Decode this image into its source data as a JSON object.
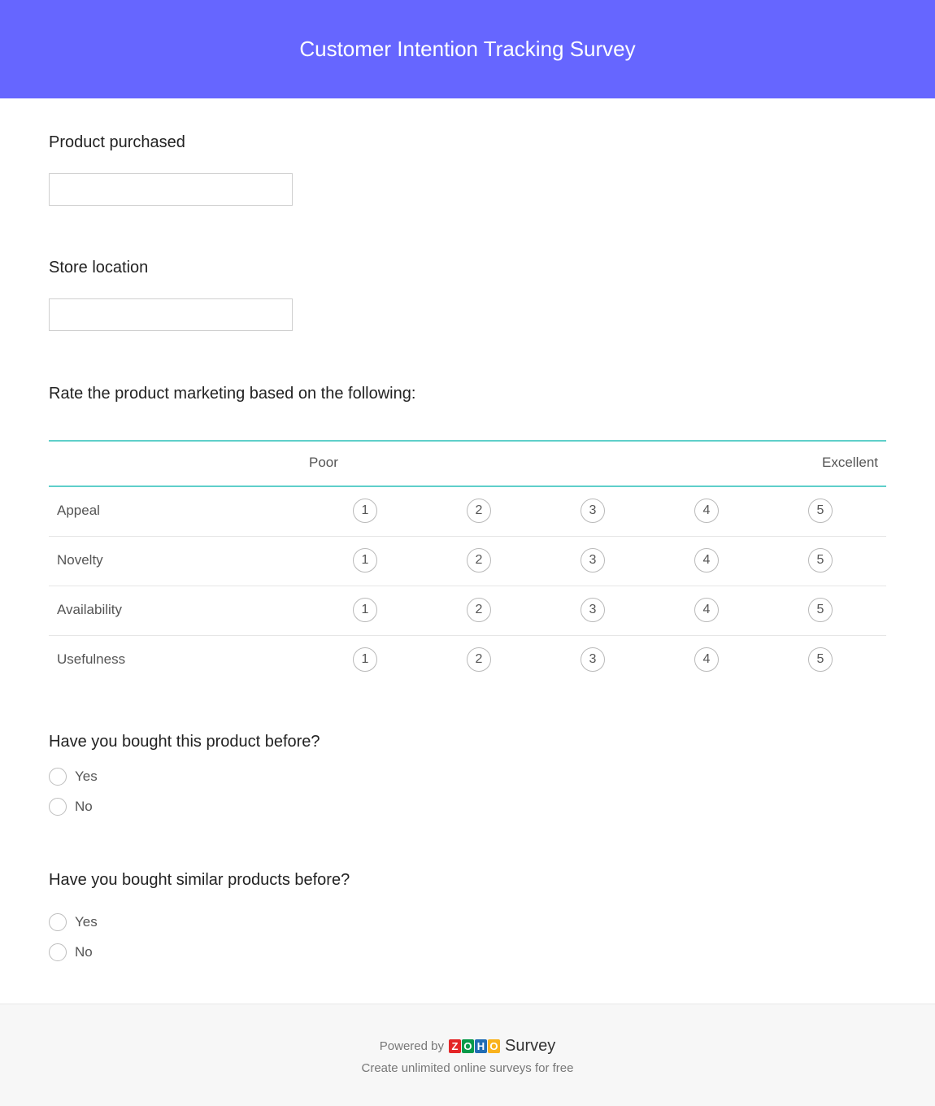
{
  "header": {
    "title": "Customer Intention Tracking Survey"
  },
  "questions": {
    "product": {
      "label": "Product purchased",
      "value": ""
    },
    "store": {
      "label": "Store location",
      "value": ""
    },
    "rating": {
      "label": "Rate the product marketing based on the following:",
      "scale_low": "Poor",
      "scale_high": "Excellent",
      "scale": [
        "1",
        "2",
        "3",
        "4",
        "5"
      ],
      "rows": [
        "Appeal",
        "Novelty",
        "Availability",
        "Usefulness"
      ]
    },
    "bought_before": {
      "label": "Have you bought this product before?",
      "options": [
        "Yes",
        "No"
      ]
    },
    "similar_before": {
      "label": "Have you bought similar products before?",
      "options": [
        "Yes",
        "No"
      ]
    }
  },
  "footer": {
    "powered_by": "Powered by",
    "logo_letters": [
      "Z",
      "O",
      "H",
      "O"
    ],
    "logo_colors": [
      "#e42527",
      "#089949",
      "#226db4",
      "#f9b21d"
    ],
    "brand": "Survey",
    "tagline": "Create unlimited online surveys for free"
  },
  "colors": {
    "header_bg": "#6666ff",
    "matrix_rule": "#5fcfca"
  }
}
